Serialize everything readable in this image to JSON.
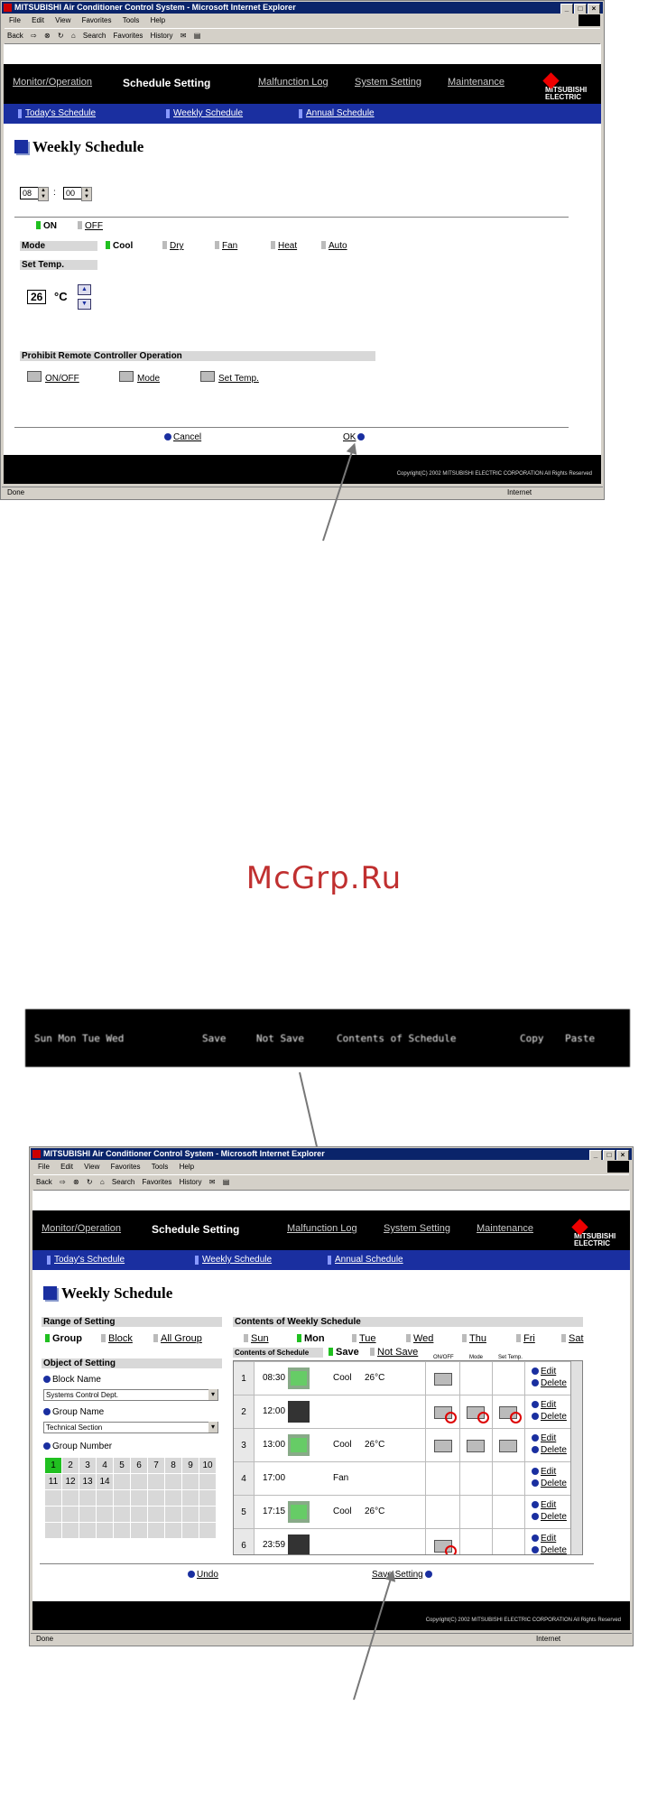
{
  "window": {
    "title": "MITSUBISHI Air Conditioner Control System - Microsoft Internet Explorer",
    "menu": [
      "File",
      "Edit",
      "View",
      "Favorites",
      "Tools",
      "Help"
    ],
    "toolbar": [
      "Back",
      "Search",
      "Favorites",
      "History"
    ],
    "status_left": "Done",
    "status_right": "Internet"
  },
  "nav": {
    "items": [
      "Monitor/Operation",
      "Schedule Setting",
      "Malfunction Log",
      "System Setting",
      "Maintenance"
    ],
    "sub": [
      "Today's Schedule",
      "Weekly Schedule",
      "Annual Schedule"
    ],
    "logo_line1": "MITSUBISHI",
    "logo_line2": "ELECTRIC"
  },
  "page_title": "Weekly Schedule",
  "copyright": "Copyright(C) 2002 MITSUBISHI ELECTRIC CORPORATION All Rights Reserved",
  "screen1": {
    "hour": "08",
    "minute": "00",
    "time_sep": ":",
    "on": "ON",
    "off": "OFF",
    "mode_label": "Mode",
    "modes": [
      "Cool",
      "Dry",
      "Fan",
      "Heat",
      "Auto"
    ],
    "settemp_label": "Set Temp.",
    "temp": "26",
    "temp_unit": "°C",
    "prohibit_label": "Prohibit Remote Controller Operation",
    "prohibit": [
      "ON/OFF",
      "Mode",
      "Set Temp."
    ],
    "cancel": "Cancel",
    "ok": "OK"
  },
  "watermark": "McGrp.Ru",
  "blurred_bar": [
    "Sun Mon Tue Wed",
    "Save",
    "Not Save",
    "Contents of Schedule",
    "Copy",
    "Paste"
  ],
  "screen2": {
    "range_label": "Range of Setting",
    "range": [
      "Group",
      "Block",
      "All Group"
    ],
    "object_label": "Object of Setting",
    "block_name_label": "Block Name",
    "block_name": "Systems Control Dept.",
    "group_name_label": "Group Name",
    "group_name": "Technical Section",
    "group_number_label": "Group Number",
    "group_numbers": [
      "1",
      "2",
      "3",
      "4",
      "5",
      "6",
      "7",
      "8",
      "9",
      "10",
      "11",
      "12",
      "13",
      "14"
    ],
    "contents_label": "Contents of Weekly Schedule",
    "days": [
      "Sun",
      "Mon",
      "Tue",
      "Wed",
      "Thu",
      "Fri",
      "Sat"
    ],
    "contents_schedule": "Contents of Schedule",
    "save": "Save",
    "not_save": "Not Save",
    "col_onoff": "ON/OFF",
    "col_mode": "Mode",
    "col_settemp": "Set Temp.",
    "edit": "Edit",
    "delete": "Delete",
    "rows": [
      {
        "num": "1",
        "time": "08:30",
        "mode": "Cool",
        "temp": "26°C"
      },
      {
        "num": "2",
        "time": "12:00",
        "mode": "",
        "temp": ""
      },
      {
        "num": "3",
        "time": "13:00",
        "mode": "Cool",
        "temp": "26°C"
      },
      {
        "num": "4",
        "time": "17:00",
        "mode": "Fan",
        "temp": ""
      },
      {
        "num": "5",
        "time": "17:15",
        "mode": "Cool",
        "temp": "26°C"
      },
      {
        "num": "6",
        "time": "23:59",
        "mode": "",
        "temp": ""
      }
    ],
    "undo": "Undo",
    "save_setting": "Save Setting"
  }
}
